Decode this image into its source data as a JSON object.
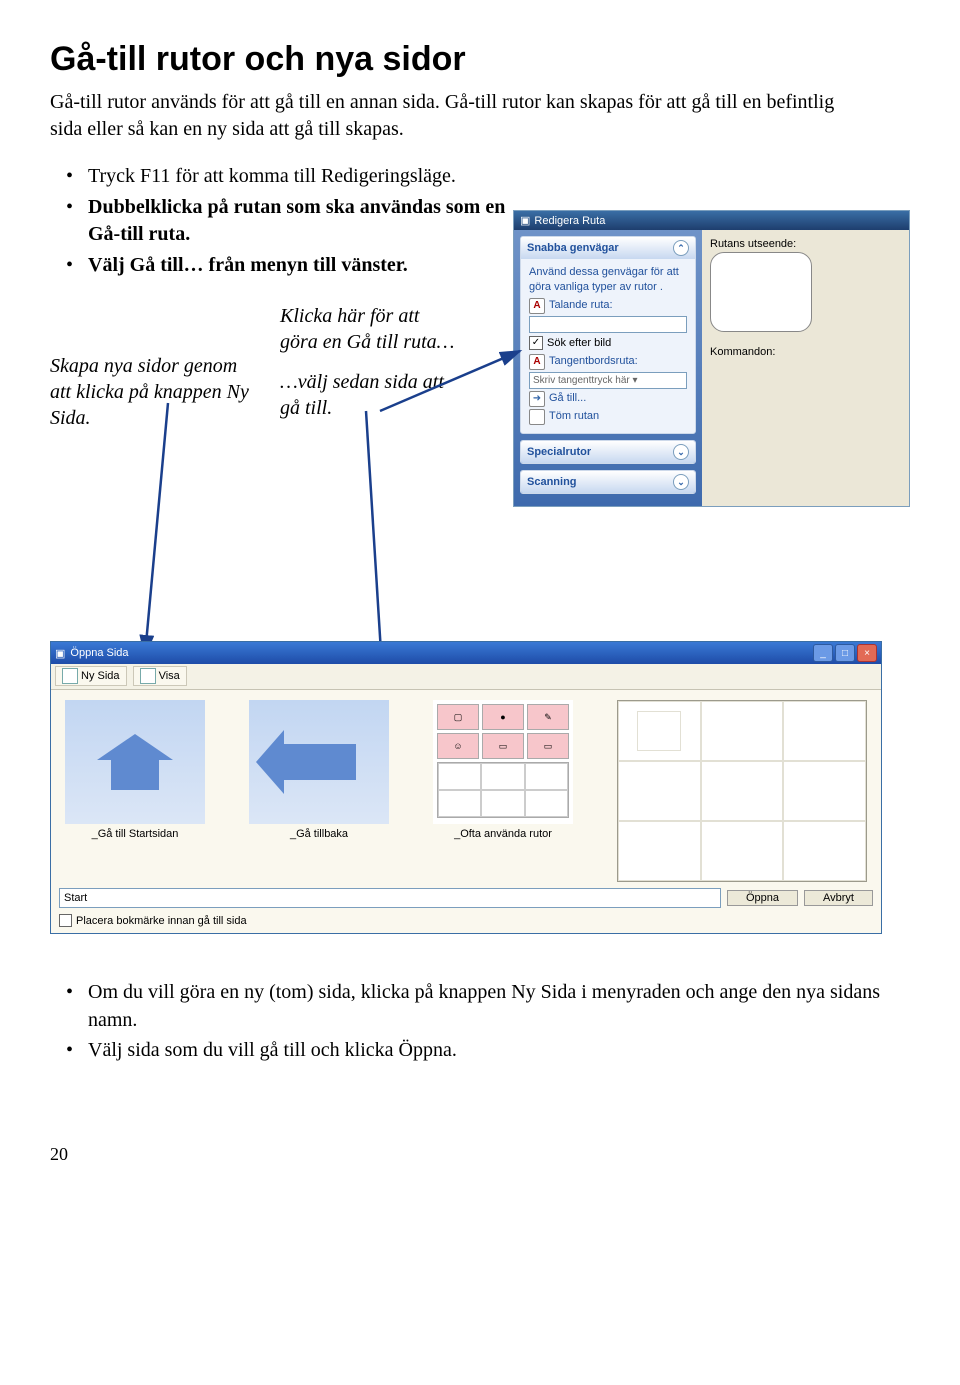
{
  "heading": "Gå-till rutor och nya sidor",
  "intro": "Gå-till rutor används för att gå till en annan sida. Gå-till rutor kan skapas för att gå till en befintlig sida eller så kan en ny sida att gå till skapas.",
  "steps": [
    "Tryck F11 för att komma till Redigeringsläge.",
    "Dubbelklicka på rutan som ska användas som en Gå-till ruta.",
    "Välj Gå till… från menyn till vänster."
  ],
  "captionLeft": "Skapa nya sidor genom att klicka på knappen Ny Sida.",
  "captionRight1": "Klicka här för att göra en Gå till ruta…",
  "captionRight2": "…välj sedan sida att gå till.",
  "panel": {
    "title": "Redigera Ruta",
    "sectionShortcuts": "Snabba genvägar",
    "shortcutsDesc": "Använd dessa genvägar för att göra vanliga typer av rutor .",
    "talkingCell": "Talande ruta:",
    "searchImage": "Sök efter bild",
    "keyboardCell": "Tangentbordsruta:",
    "keyboardPlaceholder": "Skriv tangenttryck här ▾",
    "goTo": "Gå till...",
    "clearCell": "Töm rutan",
    "sectionSpecial": "Specialrutor",
    "sectionScanning": "Scanning",
    "rightAppearance": "Rutans utseende:",
    "rightCommands": "Kommandon:"
  },
  "openWin": {
    "title": "Öppna Sida",
    "tabNew": "Ny Sida",
    "tabView": "Visa",
    "thumbHome": "_Gå till Startsidan",
    "thumbBack": "_Gå tillbaka",
    "thumbOften": "_Ofta använda rutor",
    "pathValue": "Start",
    "btnOpen": "Öppna",
    "btnCancel": "Avbryt",
    "bookmarkLabel": "Placera bokmärke innan gå till sida"
  },
  "footerBullets": [
    "Om du vill göra en ny (tom) sida, klicka på knappen Ny Sida i menyraden och ange den nya sidans namn.",
    "Välj sida som du vill gå till och klicka Öppna."
  ],
  "pageNumber": "20"
}
